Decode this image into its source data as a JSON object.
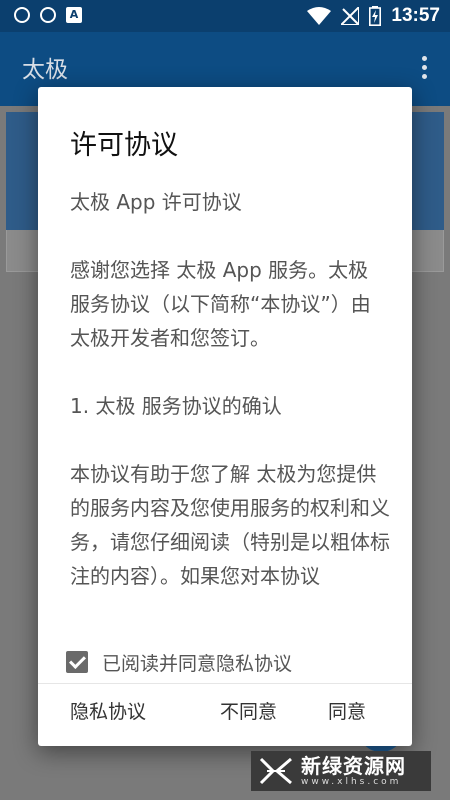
{
  "status_bar": {
    "time": "13:57",
    "notification_icons": [
      "shield-icon",
      "shield-icon",
      "app-a-icon"
    ],
    "app_a_letter": "A"
  },
  "toolbar": {
    "title": "太极"
  },
  "dialog": {
    "title": "许可协议",
    "paragraphs": [
      "太极 App 许可协议",
      "感谢您选择 太极 App 服务。太极 服务协议（以下简称“本协议”）由 太极开发者和您签订。",
      "1. 太极 服务协议的确认",
      "本协议有助于您了解 太极为您提供的服务内容及您使用服务的权利和义务，请您仔细阅读（特别是以粗体标注的内容）。如果您对本协议"
    ],
    "checkbox_label": "已阅读并同意隐私协议",
    "checkbox_checked": true,
    "buttons": {
      "privacy": "隐私协议",
      "disagree": "不同意",
      "agree": "同意"
    }
  },
  "watermark": {
    "main": "新绿资源网",
    "sub": "www.xlhs.com"
  },
  "colors": {
    "statusbar": "#0b3f6e",
    "toolbar": "#0d4c83",
    "scrim": "#7a7a7a",
    "checkbox": "#6a6a6a"
  }
}
